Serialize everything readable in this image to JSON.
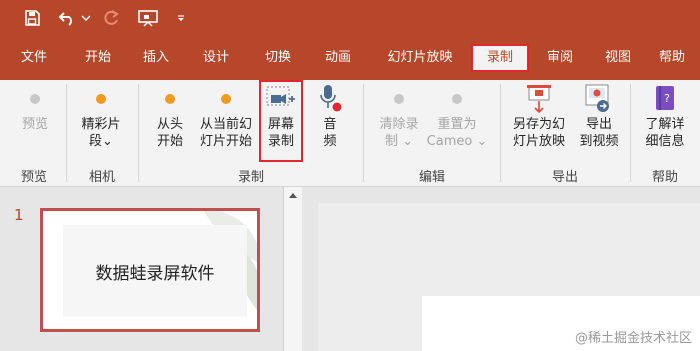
{
  "quick_access": {
    "icons": [
      "save-icon",
      "undo-icon",
      "undo-dropdown-icon",
      "redo-icon",
      "slideshow-icon",
      "customize-icon"
    ]
  },
  "tabs": [
    {
      "label": "文件",
      "active": false
    },
    {
      "label": "开始",
      "active": false
    },
    {
      "label": "插入",
      "active": false
    },
    {
      "label": "设计",
      "active": false
    },
    {
      "label": "切换",
      "active": false
    },
    {
      "label": "动画",
      "active": false
    },
    {
      "label": "幻灯片放映",
      "active": false
    },
    {
      "label": "录制",
      "active": true
    },
    {
      "label": "审阅",
      "active": false
    },
    {
      "label": "视图",
      "active": false
    },
    {
      "label": "帮助",
      "active": false
    }
  ],
  "ribbon": {
    "buttons": [
      {
        "id": "preview",
        "label": "预览",
        "icon": "preview-dot-icon",
        "enabled": false
      },
      {
        "id": "cameo",
        "label": "精彩片\n段⌄",
        "icon": "cameo-dot-icon",
        "enabled": true
      },
      {
        "id": "from-start",
        "label": "从头\n开始",
        "icon": "record-dot-icon",
        "enabled": true
      },
      {
        "id": "from-current",
        "label": "从当前幻\n灯片开始",
        "icon": "record-dot-icon",
        "enabled": true
      },
      {
        "id": "screen-record",
        "label": "屏幕\n录制",
        "icon": "screen-recording-icon",
        "enabled": true
      },
      {
        "id": "audio",
        "label": "音\n频",
        "icon": "microphone-icon",
        "enabled": true
      },
      {
        "id": "clear",
        "label": "清除录\n制 ⌄",
        "icon": "clear-dot-icon",
        "enabled": false
      },
      {
        "id": "reset-cameo",
        "label": "重置为\nCameo ⌄",
        "icon": "reset-dot-icon",
        "enabled": false
      },
      {
        "id": "save-show",
        "label": "另存为幻\n灯片放映",
        "icon": "save-as-show-icon",
        "enabled": true
      },
      {
        "id": "export-video",
        "label": "导出\n到视频",
        "icon": "export-video-icon",
        "enabled": true
      },
      {
        "id": "learn-more",
        "label": "了解详\n细信息",
        "icon": "book-icon",
        "enabled": true
      }
    ],
    "groups": [
      {
        "label": "预览"
      },
      {
        "label": "相机"
      },
      {
        "label": "录制"
      },
      {
        "label": "编辑"
      },
      {
        "label": "导出"
      },
      {
        "label": "帮助"
      }
    ]
  },
  "slides_pane": {
    "slide_number": "1",
    "thumbnail_text": "数据蛙录屏软件"
  },
  "watermark": "@稀土掘金技术社区",
  "colors": {
    "titlebar": "#b7472a",
    "accent": "#b7472a",
    "highlight": "#e0282e",
    "ribbon_bg": "#f3f3f3",
    "record_dot": "#f29a1f"
  }
}
